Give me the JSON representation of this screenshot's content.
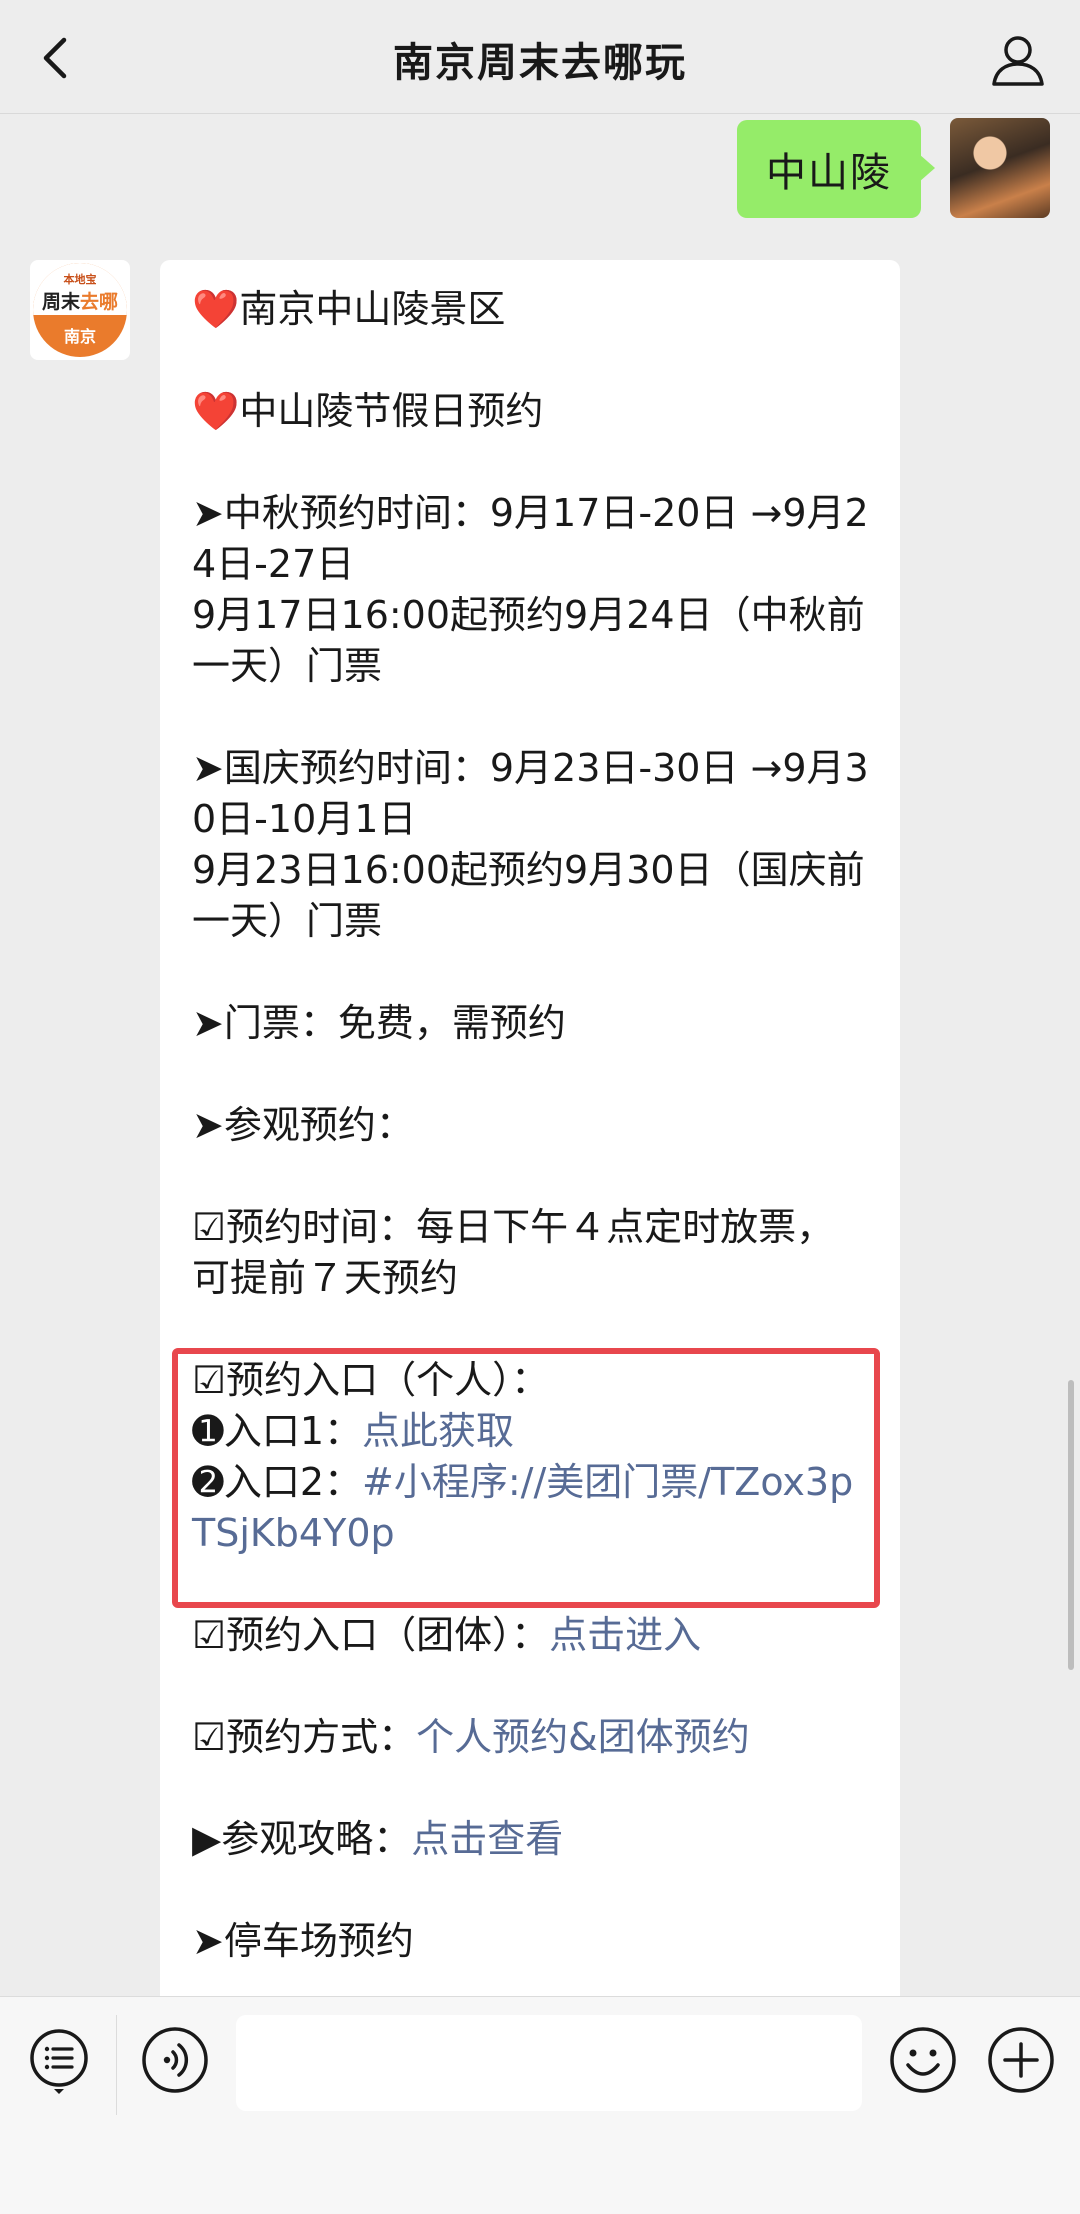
{
  "header": {
    "title": "南京周末去哪玩"
  },
  "messages": {
    "outgoing_text": "中山陵",
    "logo": {
      "small_text": "本地宝",
      "main_text_a": "周末",
      "main_text_b": "去哪",
      "city": "南京"
    },
    "incoming": {
      "l1": "❤️南京中山陵景区",
      "l2": "❤️中山陵节假日预约",
      "l3": "➤中秋预约时间：9月17日-20日 →9月24日-27日",
      "l4": "9月17日16:00起预约9月24日（中秋前一天）门票",
      "l5": "➤国庆预约时间：9月23日-30日 →9月30日-10月1日",
      "l6": "9月23日16:00起预约9月30日（国庆前一天）门票",
      "l7": "➤门票：免费，需预约",
      "l8": "➤参观预约：",
      "l9": "☑预约时间：每日下午４点定时放票，可提前７天预约",
      "l10": "☑预约入口（个人）：",
      "l11_prefix": "➊入口1：",
      "l11_link": "点此获取",
      "l12_prefix": "➋入口2：",
      "l12_link": "#小程序://美团门票/TZox3pTSjKb4Y0p",
      "l13_prefix": "☑预约入口（团体）：",
      "l13_link": "点击进入",
      "l14_prefix": "☑预约方式：",
      "l14_link": "个人预约&团体预约",
      "l15_prefix": "▶参观攻略：",
      "l15_link": "点击查看",
      "l16": "➤停车场预约"
    }
  },
  "input": {
    "value": "",
    "placeholder": ""
  },
  "colors": {
    "bubble_green": "#95ec69",
    "link": "#576b95",
    "highlight": "#e8474d",
    "brand_orange": "#ea7b2c"
  },
  "icons": [
    "back-arrow-icon",
    "person-icon",
    "menu-list-icon",
    "voice-icon",
    "emoji-icon",
    "plus-icon"
  ]
}
